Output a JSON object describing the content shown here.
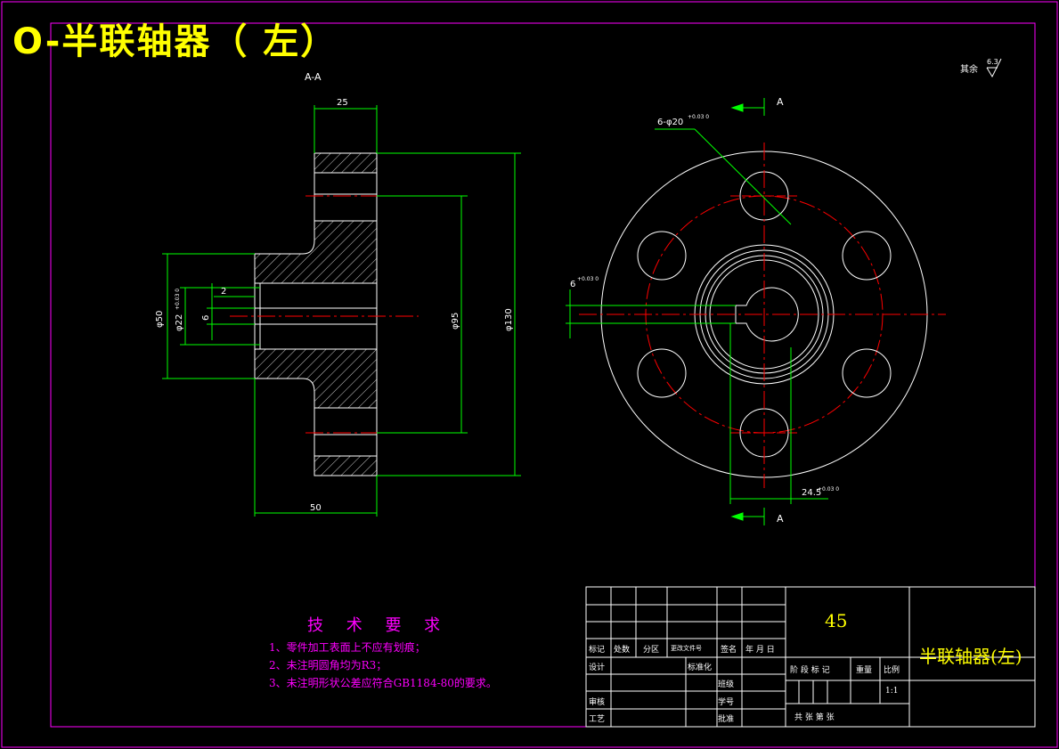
{
  "drawing": {
    "title": "O-半联轴器（  左）",
    "section_label": "A-A",
    "cut_marker_top": "A",
    "cut_marker_bottom": "A",
    "roughness_note": "其余",
    "roughness_value": "6.3"
  },
  "dimensions": {
    "d25": "25",
    "d50_len": "50",
    "phi50": "φ50",
    "phi22": "φ22",
    "phi22_tol": "+0.03 0",
    "d2": "2",
    "d6": "6",
    "phi95": "φ95",
    "phi130": "φ130",
    "holes": "6-φ20",
    "holes_tol": "+0.03 0",
    "keyway_width": "6",
    "keyway_width_tol": "+0.03 0",
    "keyway_depth": "24.5",
    "keyway_depth_tol": "+0.03 0"
  },
  "tech_requirements": {
    "heading": "技 术 要 求",
    "items": [
      "1、零件加工表面上不应有划痕；",
      "2、未注明圆角均为R3；",
      "3、未注明形状公差应符合GB1184-80的要求。"
    ]
  },
  "title_block": {
    "material": "45",
    "part_name": "半联轴器(左)",
    "labels": {
      "mark": "标记",
      "count": "处数",
      "zone": "分区",
      "change_doc": "更改文件号",
      "signature": "签名",
      "date": "年 月 日",
      "design": "设计",
      "standardize": "标准化",
      "class": "班级",
      "review": "审核",
      "student_id": "学号",
      "process": "工艺",
      "approve": "批准",
      "stage_mark": "阶 段 标 记",
      "weight": "重量",
      "scale": "比例",
      "scale_value": "1:1",
      "total_sheets": "共    张  第    张"
    }
  },
  "colors": {
    "frame": "#ff00ff",
    "outline": "#ffffff",
    "dimension": "#00ff00",
    "centerline": "#ff0000",
    "title": "#ffff00",
    "tech": "#ff00ff"
  }
}
